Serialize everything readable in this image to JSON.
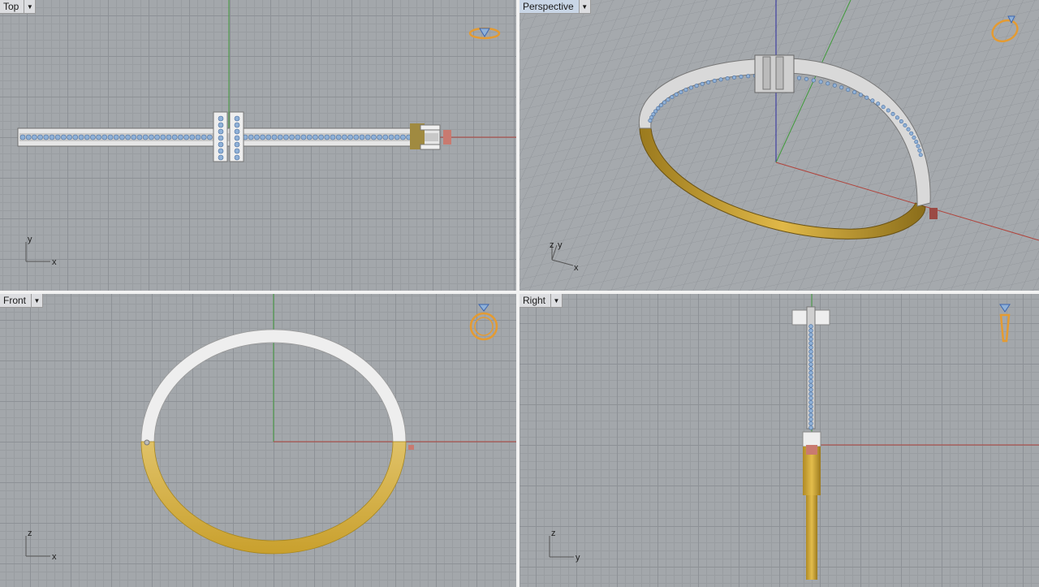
{
  "viewports": {
    "top": {
      "label": "Top",
      "axis_a": "x",
      "axis_b": "y"
    },
    "perspective": {
      "label": "Perspective",
      "axis_a": "x",
      "axis_b": "y",
      "axis_c": "z"
    },
    "front": {
      "label": "Front",
      "axis_a": "x",
      "axis_b": "z"
    },
    "right": {
      "label": "Right",
      "axis_a": "y",
      "axis_b": "z"
    }
  },
  "icons": {
    "menu_arrow": "▼",
    "view_widget": "ring-icon"
  },
  "colors": {
    "grid_bg": "#a3a7ab",
    "x_axis": "#b0443c",
    "y_axis": "#3f9a3a",
    "z_axis": "#2c2ca0",
    "gold": "#d8aa3a",
    "silver": "#e3e3e3",
    "gem": "#8fb1d8",
    "active_label": "#c9d6e6"
  }
}
